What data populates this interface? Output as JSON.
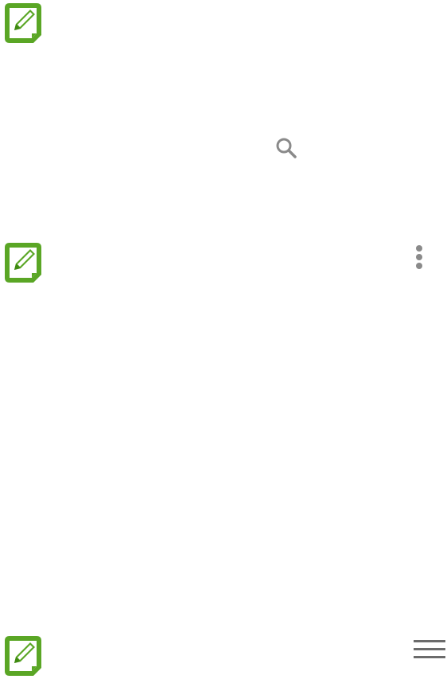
{
  "icons": {
    "note_icon": "note-pencil-icon",
    "search_icon": "search-icon",
    "more_icon": "more-vertical-icon",
    "menu_icon": "hamburger-menu-icon"
  },
  "colors": {
    "note_green": "#5aa625",
    "note_green_dark": "#3f8a12",
    "icon_gray": "#8a8a8a",
    "menu_gray": "#6b6b6b",
    "background": "#ffffff"
  }
}
